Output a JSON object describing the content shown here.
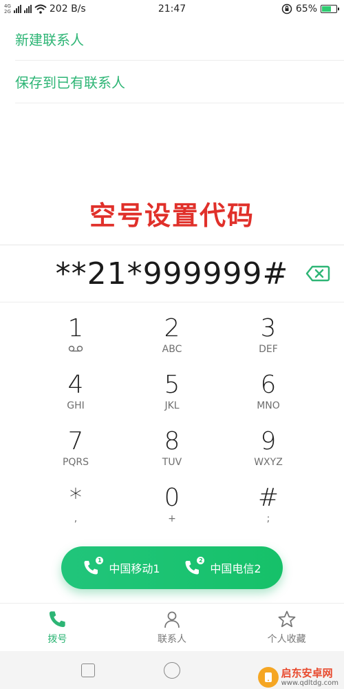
{
  "status_bar": {
    "net_top": "4G",
    "net_bottom": "2G",
    "speed": "202 B/s",
    "time": "21:47",
    "battery": "65%",
    "battery_level": 0.65
  },
  "menu": {
    "new_contact": "新建联系人",
    "save_existing": "保存到已有联系人"
  },
  "caption": "空号设置代码",
  "dialer": {
    "number": "**21*999999#"
  },
  "keypad": [
    {
      "digit": "1",
      "letters": ""
    },
    {
      "digit": "2",
      "letters": "ABC"
    },
    {
      "digit": "3",
      "letters": "DEF"
    },
    {
      "digit": "4",
      "letters": "GHI"
    },
    {
      "digit": "5",
      "letters": "JKL"
    },
    {
      "digit": "6",
      "letters": "MNO"
    },
    {
      "digit": "7",
      "letters": "PQRS"
    },
    {
      "digit": "8",
      "letters": "TUV"
    },
    {
      "digit": "9",
      "letters": "WXYZ"
    },
    {
      "digit": "*",
      "letters": ","
    },
    {
      "digit": "0",
      "letters": "+"
    },
    {
      "digit": "#",
      "letters": ";"
    }
  ],
  "call": {
    "sim1_label": "中国移动1",
    "sim1_badge": "1",
    "sim2_label": "中国电信2",
    "sim2_badge": "2"
  },
  "bottom_nav": {
    "dial": "拨号",
    "contacts": "联系人",
    "favorites": "个人收藏"
  },
  "watermark": {
    "title": "启东安卓网",
    "url": "www.qdltdg.com"
  },
  "colors": {
    "accent": "#2db575",
    "caption": "#e0302a",
    "call_button": "#1ec372"
  }
}
